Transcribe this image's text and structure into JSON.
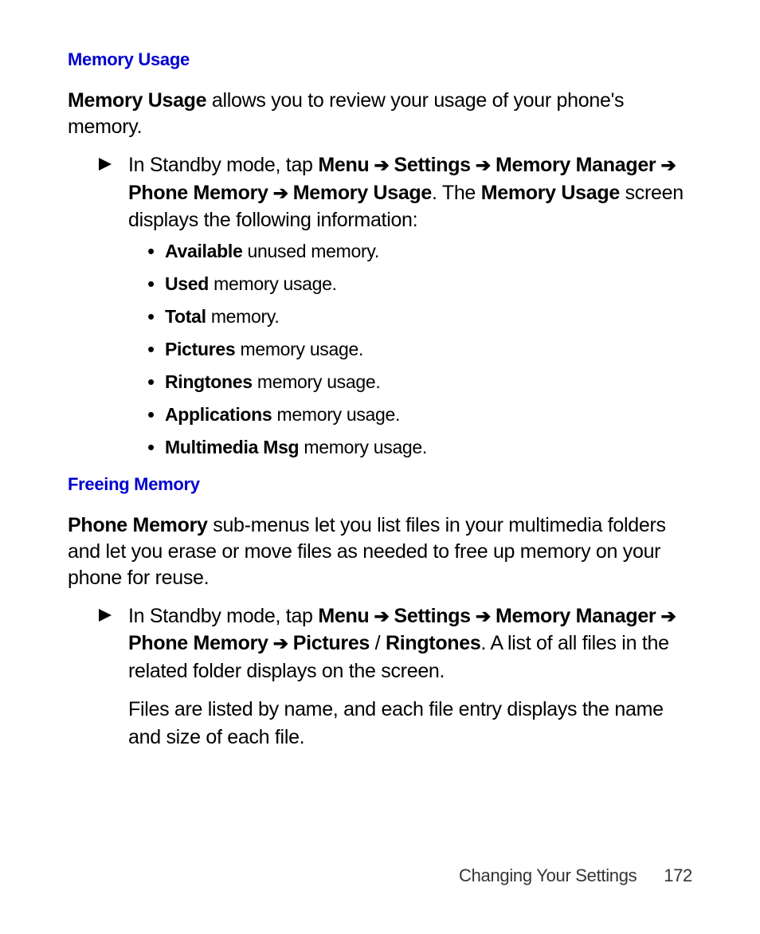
{
  "section1": {
    "heading": "Memory Usage",
    "intro_bold": "Memory Usage",
    "intro_rest": " allows you to review your usage of your phone's memory.",
    "step_prefix": "In Standby mode, tap ",
    "nav1": "Menu",
    "arrow": " ➔ ",
    "nav2": "Settings",
    "nav3": "Memory Manager",
    "nav4": "Phone Memory",
    "nav5": "Memory Usage",
    "step_suffix1": ". The ",
    "step_bold2": "Memory Usage",
    "step_suffix2": " screen displays the following information:",
    "bullets": [
      {
        "b": "Available",
        "r": " unused memory."
      },
      {
        "b": "Used",
        "r": " memory usage."
      },
      {
        "b": "Total",
        "r": " memory."
      },
      {
        "b": "Pictures",
        "r": " memory usage."
      },
      {
        "b": "Ringtones",
        "r": " memory usage."
      },
      {
        "b": "Applications",
        "r": " memory usage."
      },
      {
        "b": "Multimedia Msg",
        "r": " memory usage."
      }
    ]
  },
  "section2": {
    "heading": "Freeing Memory",
    "intro_bold": "Phone Memory",
    "intro_rest": " sub-menus let you list files in your multimedia folders and let you erase or move files as needed to free up memory on your phone for reuse.",
    "step_prefix": "In Standby mode, tap ",
    "nav1": "Menu",
    "arrow": " ➔ ",
    "nav2": "Settings",
    "nav3": "Memory Manager",
    "nav4": "Phone Memory",
    "nav5": "Pictures",
    "slash": " / ",
    "nav6": "Ringtones",
    "step_suffix": ". A list of all files in the related folder displays on the screen.",
    "extra": "Files are listed by name, and each file entry displays the name and size of each file."
  },
  "footer": {
    "label": "Changing Your Settings",
    "page": "172"
  }
}
